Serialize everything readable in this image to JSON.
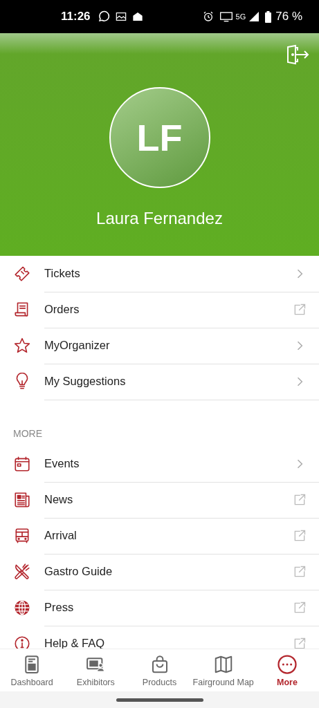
{
  "status_bar": {
    "time": "11:26",
    "network": "5G",
    "battery": "76 %"
  },
  "profile": {
    "initials": "LF",
    "name": "Laura Fernandez"
  },
  "menu": [
    {
      "label": "Tickets",
      "kind": "chevron"
    },
    {
      "label": "Orders",
      "kind": "external"
    },
    {
      "label": "MyOrganizer",
      "kind": "chevron"
    },
    {
      "label": "My Suggestions",
      "kind": "chevron"
    }
  ],
  "more_section": {
    "title": "MORE",
    "items": [
      {
        "label": "Events",
        "kind": "chevron"
      },
      {
        "label": "News",
        "kind": "external"
      },
      {
        "label": "Arrival",
        "kind": "external"
      },
      {
        "label": "Gastro Guide",
        "kind": "external"
      },
      {
        "label": "Press",
        "kind": "external"
      },
      {
        "label": "Help & FAQ",
        "kind": "external"
      }
    ]
  },
  "bottom_nav": [
    {
      "label": "Dashboard",
      "selected": false
    },
    {
      "label": "Exhibitors",
      "selected": false
    },
    {
      "label": "Products",
      "selected": false
    },
    {
      "label": "Fairground Map",
      "selected": false
    },
    {
      "label": "More",
      "selected": true
    }
  ]
}
